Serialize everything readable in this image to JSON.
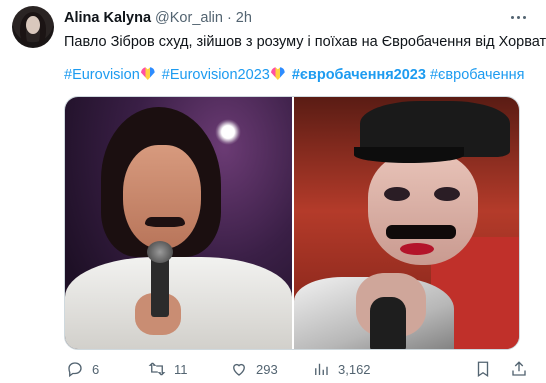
{
  "tweet": {
    "author_name": "Alina Kalyna",
    "author_handle": "@Kor_alin",
    "separator": "·",
    "time": "2h",
    "text": "Павло Зібров схуд, зійшов з розуму і поїхав на Євробачення від Хорватії.",
    "hashtags": [
      {
        "text": "#Eurovision",
        "bold": false,
        "emoji": "heart-icon"
      },
      {
        "text": "#Eurovision2023",
        "bold": false,
        "emoji": "heart-icon"
      },
      {
        "text": "#євробачення2023",
        "bold": true,
        "emoji": null
      },
      {
        "text": "#євробачення",
        "bold": false,
        "emoji": null
      }
    ],
    "media": [
      {
        "alt": "Singer in white jacket holding a microphone on a purple stage"
      },
      {
        "alt": "Performer in black cap with painted moustache singing into a microphone"
      }
    ],
    "actions": {
      "reply_count": "6",
      "retweet_count": "11",
      "like_count": "293",
      "view_count": "3,162"
    }
  },
  "colors": {
    "accent": "#1d9bf0",
    "text": "#0f1419",
    "secondary": "#536471"
  }
}
